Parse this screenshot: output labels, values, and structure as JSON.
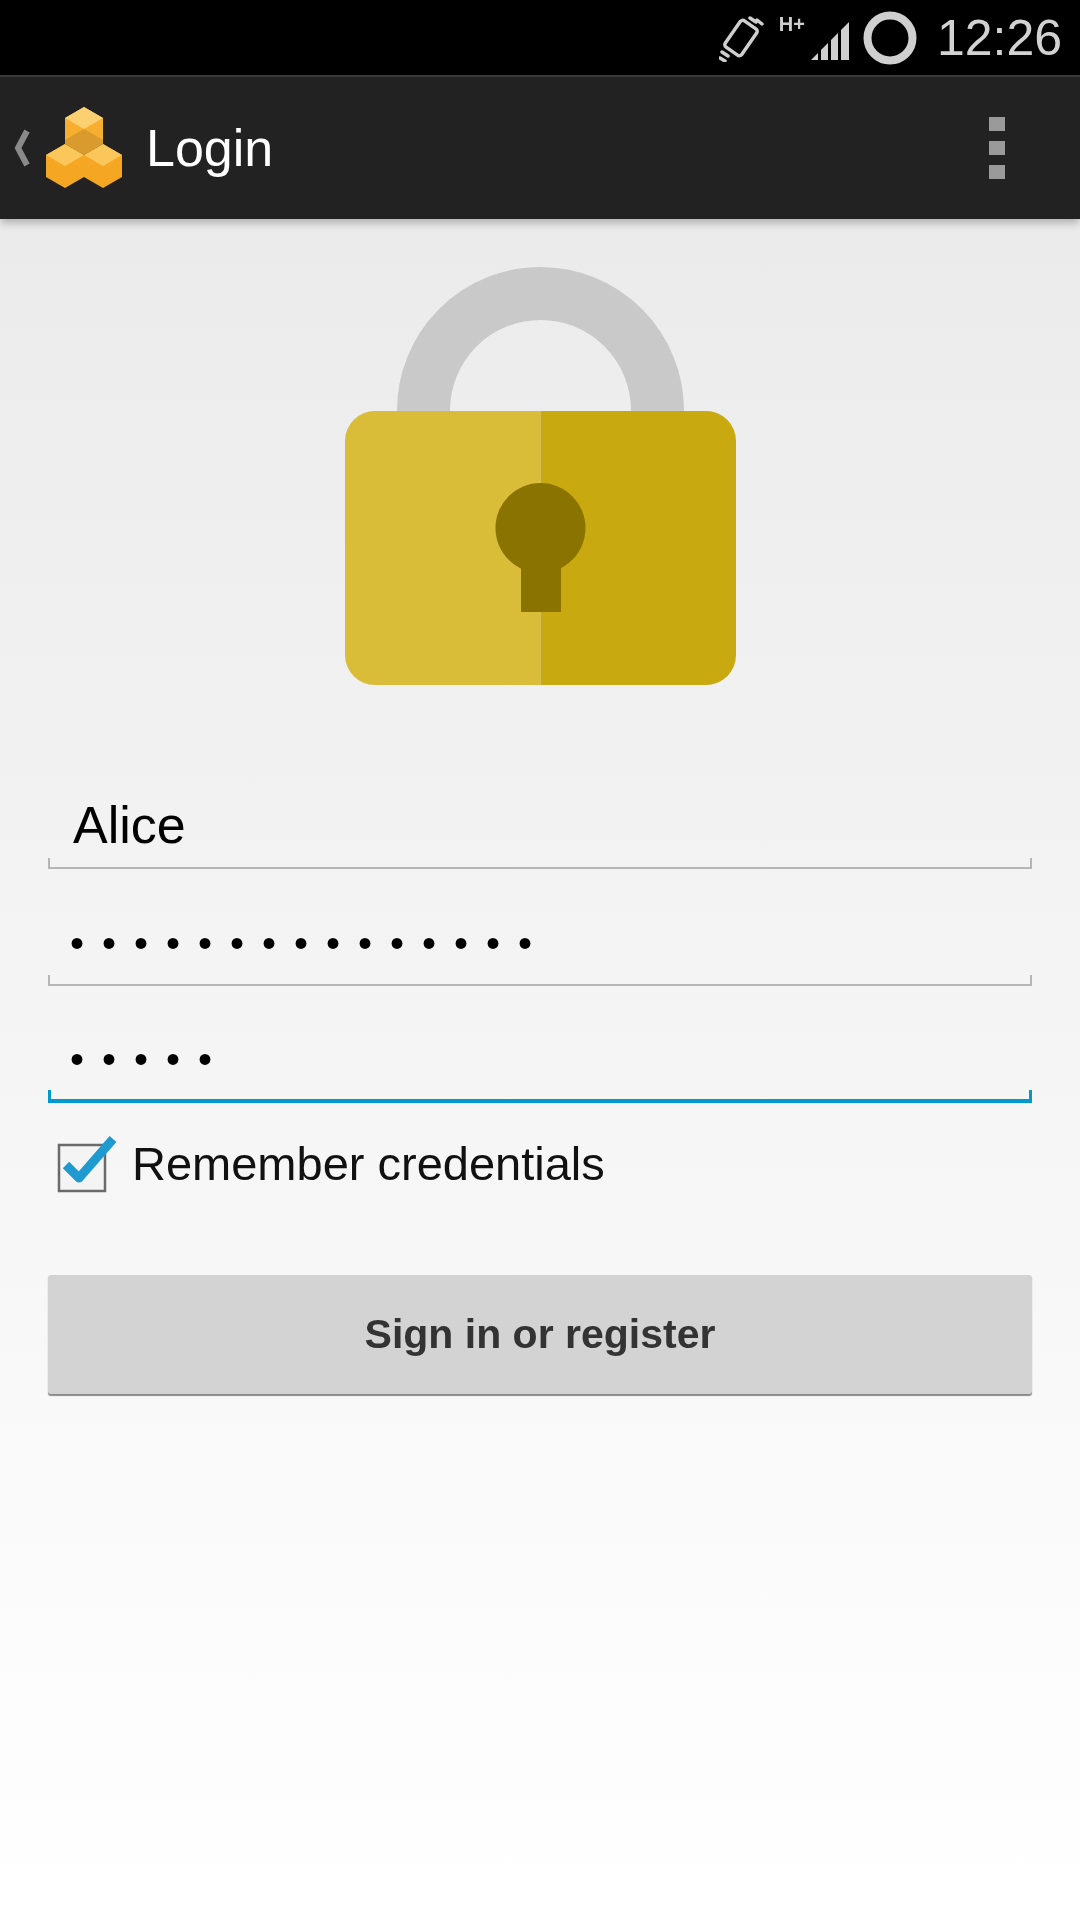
{
  "status_bar": {
    "network_type": "H+",
    "time": "12:26"
  },
  "action_bar": {
    "title": "Login"
  },
  "form": {
    "fields": [
      {
        "kind": "text",
        "value": "Alice",
        "focused": false
      },
      {
        "kind": "password",
        "value": "•••••••••••••••",
        "focused": false
      },
      {
        "kind": "password",
        "value": "•••••",
        "focused": true
      }
    ],
    "remember": {
      "label": "Remember credentials",
      "checked": true
    },
    "submit_button": {
      "label": "Sign in or register"
    }
  }
}
